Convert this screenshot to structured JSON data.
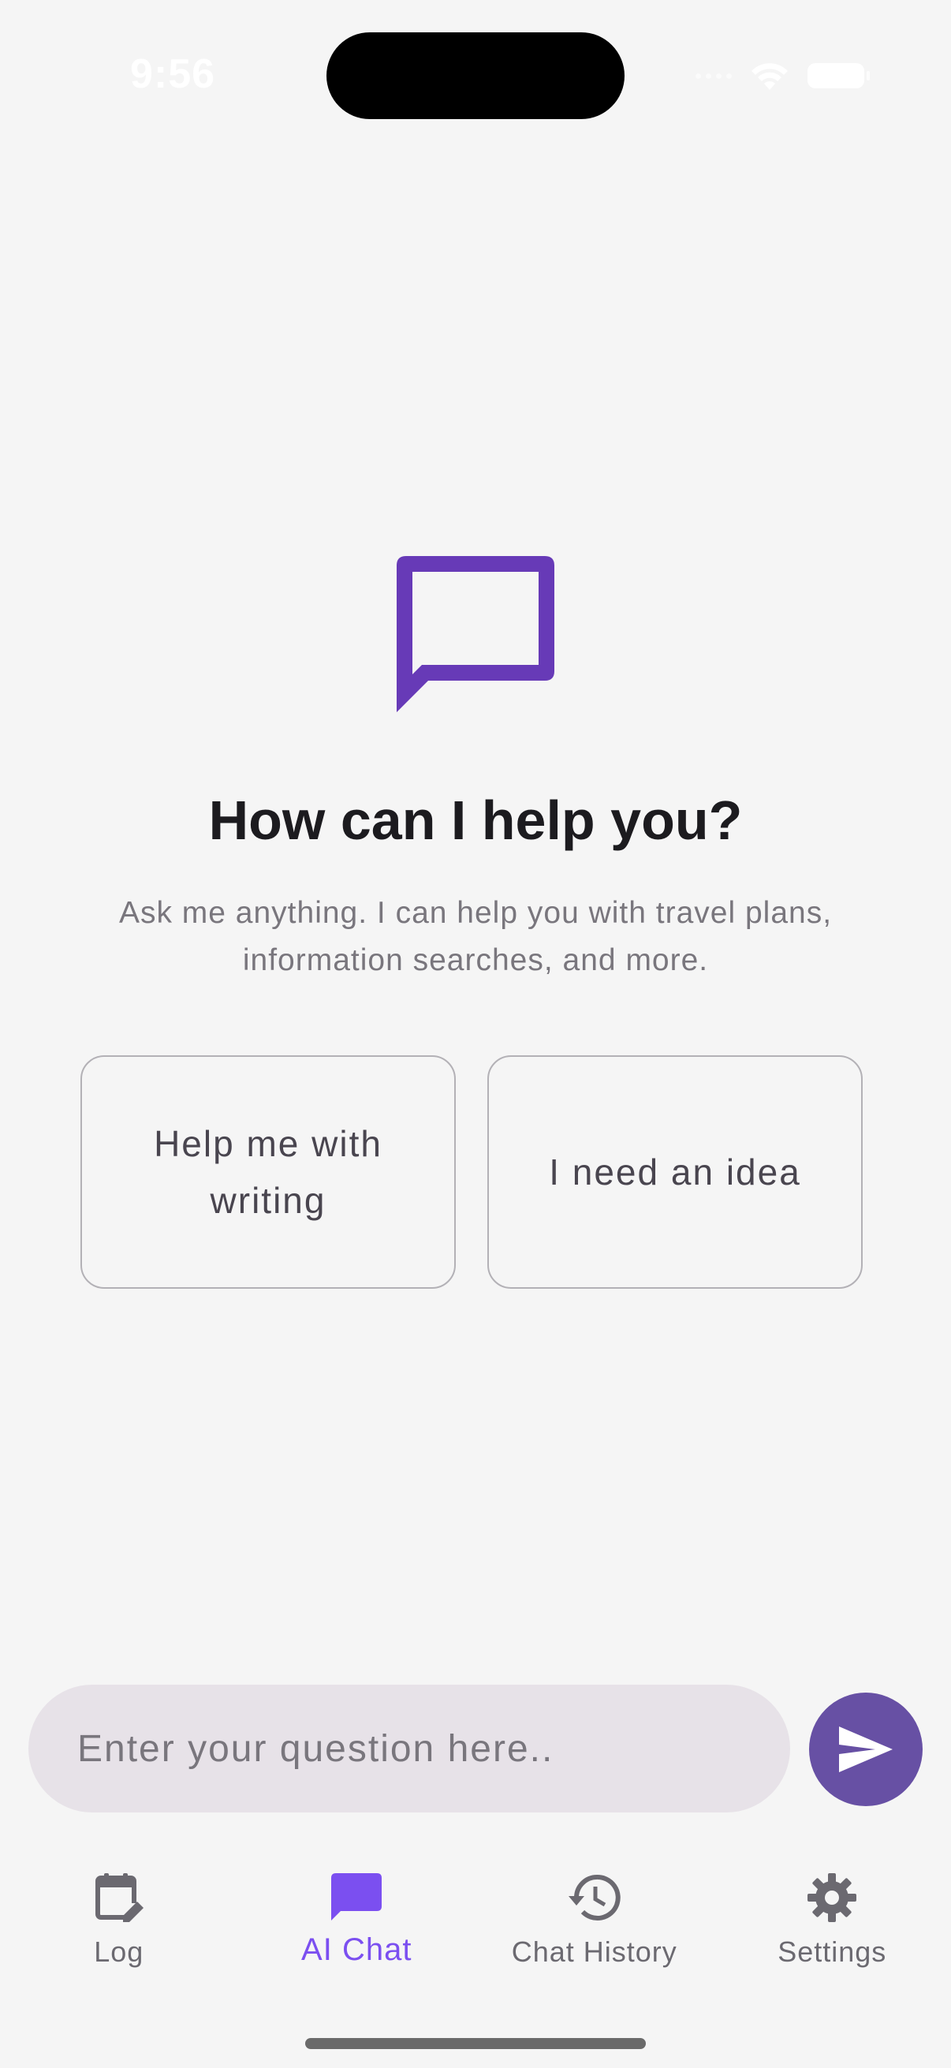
{
  "status_bar": {
    "time": "9:56"
  },
  "empty_state": {
    "icon": "chat-bubble-outline-icon",
    "title": "How can I help you?",
    "subtitle": "Ask me anything. I can help you with travel plans, information searches, and more."
  },
  "suggestions": [
    {
      "label": "Help me with writing"
    },
    {
      "label": "I need an idea"
    }
  ],
  "chat_input": {
    "value": "",
    "placeholder": "Enter your question here.."
  },
  "send_button": {
    "icon": "send-icon"
  },
  "bottom_nav": {
    "items": [
      {
        "label": "Log",
        "icon": "calendar-edit-icon",
        "active": false
      },
      {
        "label": "AI Chat",
        "icon": "chat-bubble-icon",
        "active": true
      },
      {
        "label": "Chat History",
        "icon": "history-icon",
        "active": false
      },
      {
        "label": "Settings",
        "icon": "gear-icon",
        "active": false
      }
    ]
  },
  "colors": {
    "accent": "#6750a4",
    "nav_active": "#7b4ff0",
    "hero_icon": "#673ab7",
    "background": "#f5f5f5",
    "input_fill": "#e7e2e8"
  }
}
